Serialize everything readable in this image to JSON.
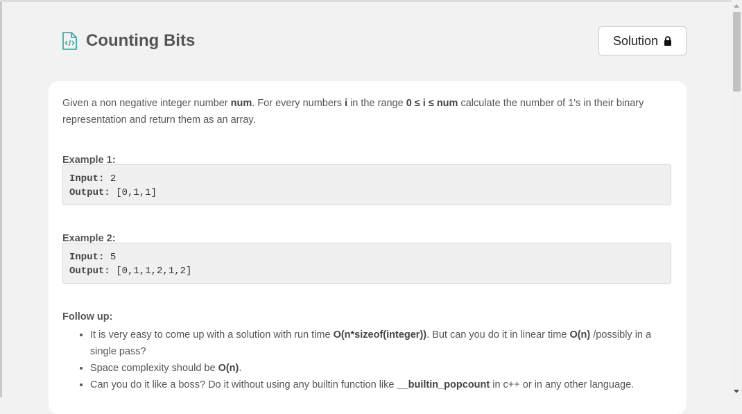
{
  "problem": {
    "title": "Counting Bits",
    "solution_label": "Solution"
  },
  "description": {
    "part1": "Given a non negative integer number ",
    "num": "num",
    "part2": ". For every numbers ",
    "i": "i",
    "part3": " in the range ",
    "range": "0 ≤ i ≤ num",
    "part4": " calculate the number of 1's in their binary representation and return them as an array."
  },
  "examples": [
    {
      "label": "Example 1:",
      "input_label": "Input:",
      "input": "2",
      "output_label": "Output:",
      "output": "[0,1,1]"
    },
    {
      "label": "Example 2:",
      "input_label": "Input:",
      "input": "5",
      "output_label": "Output:",
      "output": "[0,1,1,2,1,2]"
    }
  ],
  "follow_up": {
    "label": "Follow up:",
    "items": [
      {
        "t1": "It is very easy to come up with a solution with run time ",
        "b1": "O(n*sizeof(integer))",
        "t2": ". But can you do it in linear time ",
        "b2": "O(n)",
        "t3": " /possibly in a single pass?"
      },
      {
        "t1": "Space complexity should be ",
        "b1": "O(n)",
        "t2": "."
      },
      {
        "t1": "Can you do it like a boss? Do it without using any builtin function like ",
        "b1": "__builtin_popcount",
        "t2": " in c++ or in any other language."
      }
    ]
  },
  "colors": {
    "accent": "#26a69a",
    "background": "#f2f2f2",
    "card": "#ffffff"
  },
  "icons": {
    "title": "code-file-icon",
    "solution": "lock-icon"
  }
}
